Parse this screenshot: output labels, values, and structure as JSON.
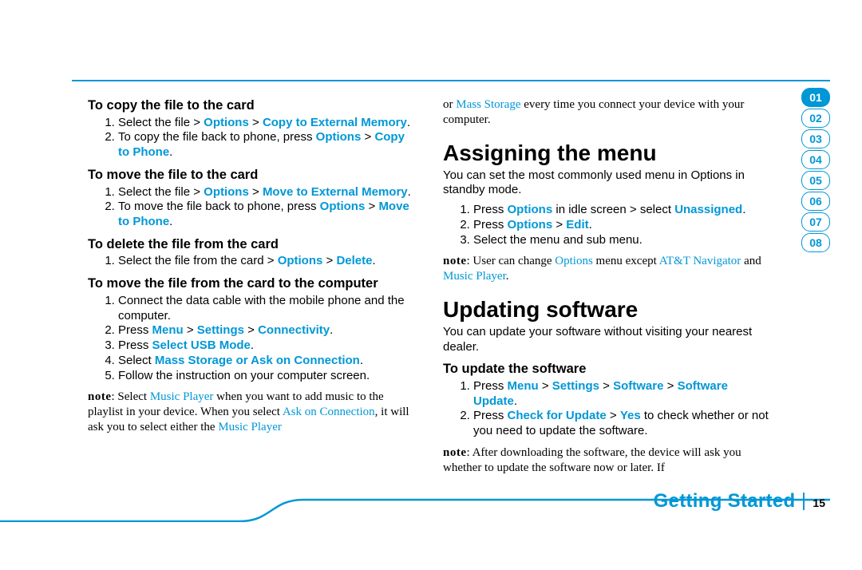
{
  "tabs": {
    "items": [
      "01",
      "02",
      "03",
      "04",
      "05",
      "06",
      "07",
      "08"
    ],
    "activeIndex": 0
  },
  "footer": {
    "section": "Getting Started",
    "page": "15"
  },
  "left": {
    "s1": {
      "title": "To copy the file to the card",
      "i1": {
        "a": "Select the file > ",
        "b": "Options",
        "c": " > ",
        "d": "Copy to External Memory",
        "e": "."
      },
      "i2": {
        "a": "To copy the file back to phone, press ",
        "b": "Options",
        "c": " > ",
        "d": "Copy to Phone",
        "e": "."
      }
    },
    "s2": {
      "title": "To move the file to the card",
      "i1": {
        "a": "Select the file > ",
        "b": "Options",
        "c": " > ",
        "d": "Move to External Memory",
        "e": "."
      },
      "i2": {
        "a": "To move the file back to phone, press ",
        "b": "Options",
        "c": " > ",
        "d": "Move to Phone",
        "e": "."
      }
    },
    "s3": {
      "title": "To delete the file from the card",
      "i1": {
        "a": "Select the file from the card > ",
        "b": "Options",
        "c": " > ",
        "d": "Delete",
        "e": "."
      }
    },
    "s4": {
      "title": "To move the file from the card to the computer",
      "i1": "Connect the data cable with the mobile phone and the computer.",
      "i2": {
        "a": "Press ",
        "b": "Menu",
        "c": " > ",
        "d": "Settings",
        "e": " > ",
        "f": "Connectivity",
        "g": "."
      },
      "i3": {
        "a": "Press ",
        "b": "Select USB Mode",
        "c": "."
      },
      "i4": {
        "a": "Select ",
        "b": "Mass Storage or Ask on Connection",
        "c": "."
      },
      "i5": "Follow the instruction on your computer screen."
    },
    "note": {
      "label": "note",
      "a": ": Select ",
      "b": "Music Player",
      "c": " when you want to add music to the playlist in your device. When you select ",
      "d": "Ask on Connection",
      "e": ", it will ask you to select either the ",
      "f": "Music Player"
    }
  },
  "right": {
    "cont": {
      "a": "or ",
      "b": "Mass Storage",
      "c": " every time you connect your device with your computer."
    },
    "h1": "Assigning the menu",
    "p1": "You can set the most commonly used menu in Options in standby mode.",
    "a1": {
      "a": "Press ",
      "b": "Options",
      "c": " in idle screen > select ",
      "d": "Unassigned",
      "e": "."
    },
    "a2": {
      "a": "Press ",
      "b": "Options",
      "c": " > ",
      "d": "Edit",
      "e": "."
    },
    "a3": "Select the menu and sub menu.",
    "note1": {
      "label": "note",
      "a": ": User can change ",
      "b": "Options",
      "c": " menu except ",
      "d": "AT&T Navigator",
      "e": " and ",
      "f": "Music Player",
      "g": "."
    },
    "h2": "Updating software",
    "p2": "You can update your software without visiting your nearest dealer.",
    "sub": "To update the software",
    "u1": {
      "a": "Press ",
      "b": "Menu",
      "c": " > ",
      "d": "Settings",
      "e": " > ",
      "f": "Software",
      "g": " > ",
      "h": "Software Update",
      "i": "."
    },
    "u2": {
      "a": "Press ",
      "b": "Check for Update",
      "c": " > ",
      "d": "Yes",
      "e": " to check whether or not you need to update the software."
    },
    "note2": {
      "label": "note",
      "a": ": After downloading the software, the device will ask you whether to update the software now or later. If"
    }
  }
}
